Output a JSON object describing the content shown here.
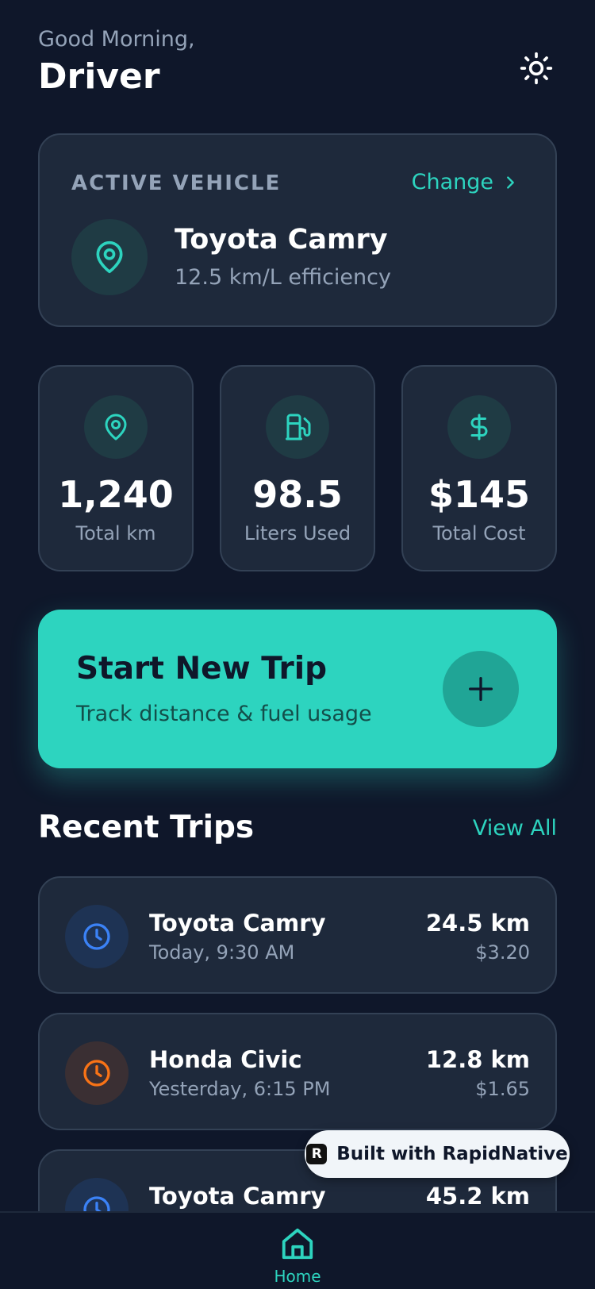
{
  "header": {
    "greeting": "Good Morning,",
    "name": "Driver",
    "theme_icon": "sun-icon"
  },
  "vehicle": {
    "section_label": "ACTIVE VEHICLE",
    "change_label": "Change",
    "name": "Toyota Camry",
    "efficiency": "12.5 km/L efficiency",
    "icon": "map-pin-icon"
  },
  "stats": [
    {
      "value": "1,240",
      "label": "Total km",
      "icon": "map-pin-icon"
    },
    {
      "value": "98.5",
      "label": "Liters Used",
      "icon": "fuel-icon"
    },
    {
      "value": "$145",
      "label": "Total Cost",
      "icon": "dollar-icon"
    }
  ],
  "new_trip": {
    "title": "Start New Trip",
    "subtitle": "Track distance & fuel usage",
    "icon": "plus-icon"
  },
  "recent": {
    "title": "Recent Trips",
    "view_all": "View All",
    "trips": [
      {
        "vehicle": "Toyota Camry",
        "time": "Today, 9:30 AM",
        "distance": "24.5 km",
        "cost": "$3.20",
        "color": "#3b82f6"
      },
      {
        "vehicle": "Honda Civic",
        "time": "Yesterday, 6:15 PM",
        "distance": "12.8 km",
        "cost": "$1.65",
        "color": "#f97316"
      },
      {
        "vehicle": "Toyota Camry",
        "time": "",
        "distance": "45.2 km",
        "cost": "",
        "color": "#3b82f6"
      }
    ]
  },
  "badge": {
    "text": "Built with RapidNative"
  },
  "tabbar": {
    "home_label": "Home"
  },
  "colors": {
    "accent": "#2dd4bf",
    "background": "#0f172a",
    "card": "#1e293b"
  }
}
